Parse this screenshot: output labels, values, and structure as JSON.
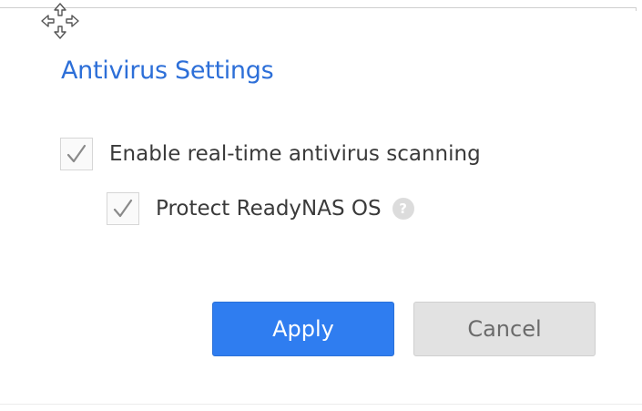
{
  "dialog": {
    "title": "Antivirus Settings",
    "icons": {
      "move_handle": "move-arrows-icon"
    }
  },
  "options": {
    "realtime_scan": {
      "label": "Enable real-time antivirus scanning",
      "checked": true
    },
    "protect_os": {
      "label": "Protect ReadyNAS OS",
      "checked": true,
      "help_glyph": "?"
    }
  },
  "buttons": {
    "apply_label": "Apply",
    "cancel_label": "Cancel"
  },
  "colors": {
    "title": "#2d6fd8",
    "apply_bg": "#2f7df0",
    "cancel_bg": "#e2e2e2",
    "checkmark": "#8a8a8a"
  }
}
